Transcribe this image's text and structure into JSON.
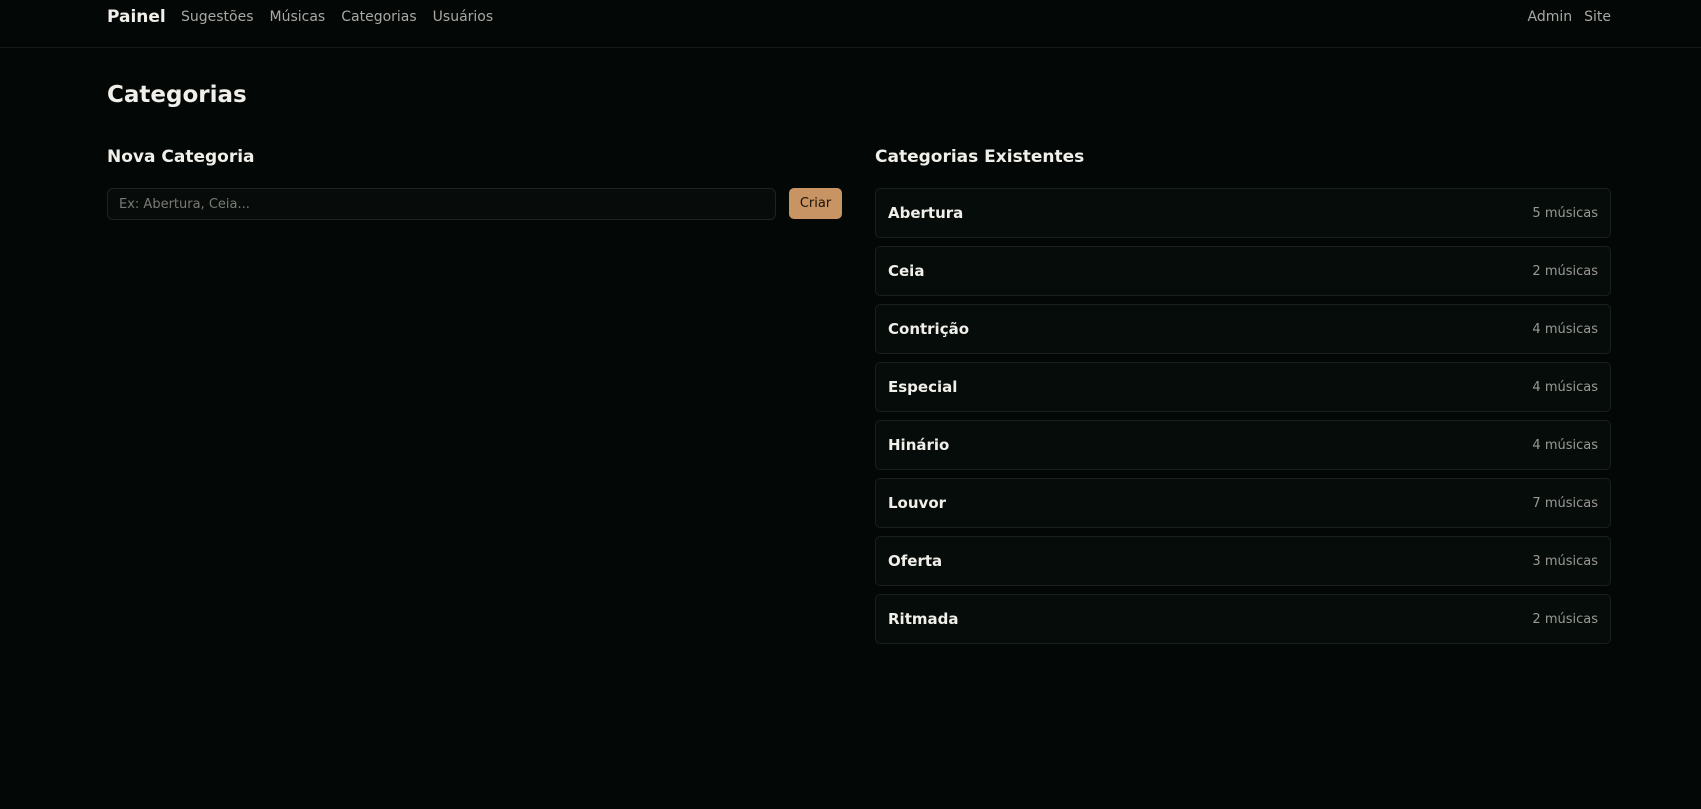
{
  "header": {
    "brand": "Painel",
    "nav": [
      "Sugestões",
      "Músicas",
      "Categorias",
      "Usuários"
    ],
    "right": [
      "Admin",
      "Site"
    ]
  },
  "page": {
    "title": "Categorias"
  },
  "new_category": {
    "title": "Nova Categoria",
    "placeholder": "Ex: Abertura, Ceia...",
    "button": "Criar"
  },
  "existing": {
    "title": "Categorias Existentes",
    "items": [
      {
        "name": "Abertura",
        "count": "5 músicas"
      },
      {
        "name": "Ceia",
        "count": "2 músicas"
      },
      {
        "name": "Contrição",
        "count": "4 músicas"
      },
      {
        "name": "Especial",
        "count": "4 músicas"
      },
      {
        "name": "Hinário",
        "count": "4 músicas"
      },
      {
        "name": "Louvor",
        "count": "7 músicas"
      },
      {
        "name": "Oferta",
        "count": "3 músicas"
      },
      {
        "name": "Ritmada",
        "count": "2 músicas"
      }
    ]
  },
  "colors": {
    "background": "#030706",
    "accent": "#c99463"
  }
}
